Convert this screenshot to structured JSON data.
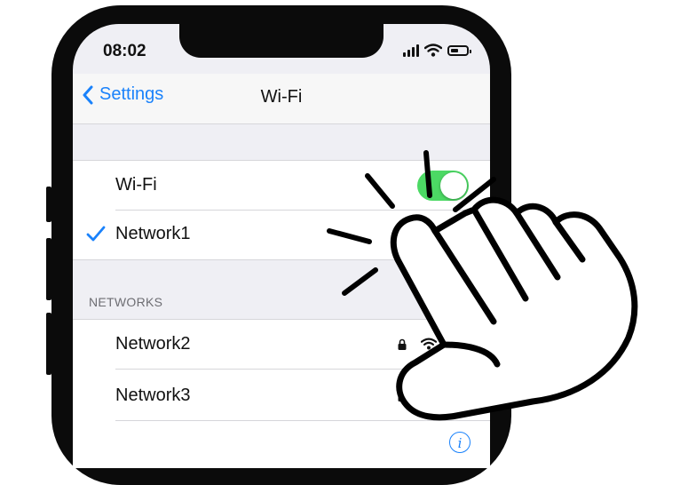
{
  "status_bar": {
    "time": "08:02"
  },
  "nav": {
    "back_label": "Settings",
    "title": "Wi-Fi"
  },
  "wifi_toggle": {
    "label": "Wi-Fi",
    "enabled": true
  },
  "connected_network": {
    "name": "Network1"
  },
  "networks_section": {
    "header": "NETWORKS",
    "items": [
      {
        "name": "Network2",
        "secured": true
      },
      {
        "name": "Network3",
        "secured": true
      }
    ]
  },
  "colors": {
    "accent": "#1a82fb",
    "toggle_on": "#4cd964",
    "background": "#efeff4",
    "phone_frame": "#0b0b0b"
  },
  "icons": [
    "chevron-left-icon",
    "checkmark-icon",
    "info-icon",
    "lock-icon",
    "wifi-icon",
    "signal-icon",
    "battery-icon",
    "tapping-hand-icon"
  ]
}
